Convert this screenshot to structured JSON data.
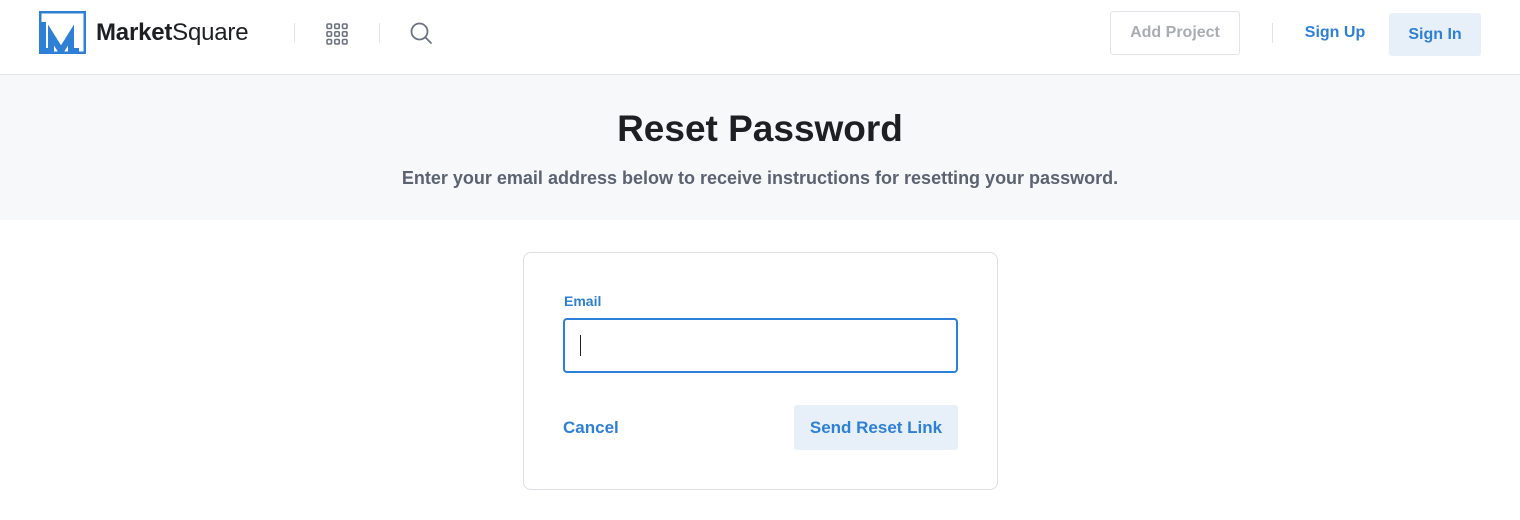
{
  "header": {
    "brand_bold": "Market",
    "brand_light": "Square",
    "logo_icon": "marketsquare-logo-icon",
    "apps_icon": "apps-grid-icon",
    "search_icon": "search-icon",
    "add_project_label": "Add Project",
    "sign_up_label": "Sign Up",
    "sign_in_label": "Sign In"
  },
  "hero": {
    "title": "Reset Password",
    "subtitle": "Enter your email address below to receive instructions for resetting your password."
  },
  "form": {
    "email_label": "Email",
    "email_value": "",
    "cancel_label": "Cancel",
    "submit_label": "Send Reset Link"
  },
  "colors": {
    "accent": "#2e7fd6",
    "button_bg": "#e7f0f9",
    "hero_bg": "#f7f8fa",
    "text_dark": "#1d1f23",
    "text_muted": "#5b6270"
  }
}
